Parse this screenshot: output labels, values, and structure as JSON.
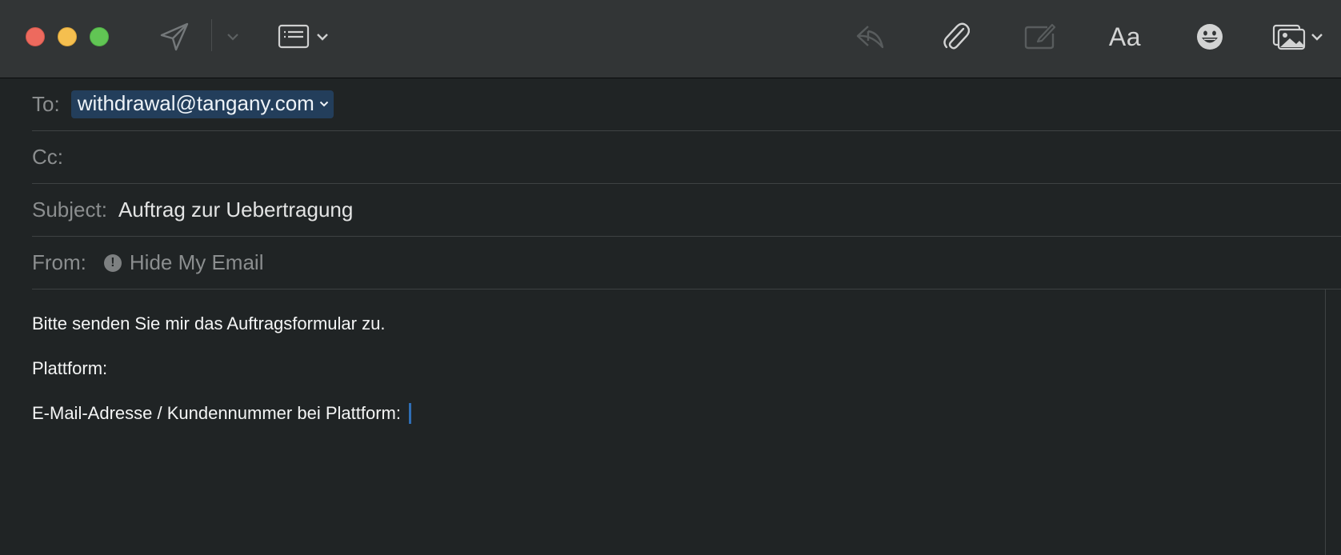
{
  "window": {
    "traffic_lights": {
      "close": "#ed6a5e",
      "minimize": "#f5bf4f",
      "maximize": "#61c554"
    }
  },
  "toolbar": {
    "icons": [
      "send-icon",
      "chevron-down-icon",
      "header-fields-icon",
      "chevron-down-icon",
      "reply-icon",
      "paperclip-icon",
      "markup-icon",
      "format-icon",
      "emoji-icon",
      "photo-browser-icon",
      "chevron-down-icon"
    ],
    "format_label": "Aa"
  },
  "header": {
    "to_label": "To:",
    "to_recipient": "withdrawal@tangany.com",
    "cc_label": "Cc:",
    "subject_label": "Subject:",
    "subject_value": "Auftrag zur Uebertragung",
    "from_label": "From:",
    "from_value": "Hide My Email",
    "from_warning_glyph": "!"
  },
  "body": {
    "line1": "Bitte senden Sie mir das Auftragsformular zu.",
    "line2": "Plattform:",
    "line3": "E-Mail-Adresse / Kundennummer bei Plattform:"
  },
  "colors": {
    "toolbar_bg": "#323536",
    "content_bg": "#202425",
    "token_bg": "#233e5b",
    "caret": "#2f6eb5"
  }
}
